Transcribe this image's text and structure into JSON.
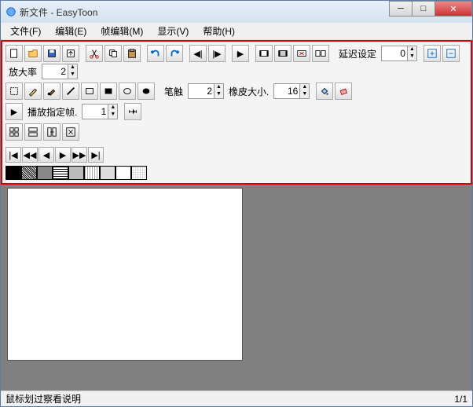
{
  "title": "新文件 - EasyToon",
  "menus": {
    "file": "文件(F)",
    "edit": "编辑(E)",
    "frame": "帧编辑(M)",
    "display": "显示(V)",
    "help": "帮助(H)"
  },
  "toolbar1": {
    "delay_label": "延迟设定",
    "delay_value": "0",
    "zoom_label": "放大率",
    "zoom_value": "2"
  },
  "toolbar2": {
    "pen_label": "笔触",
    "pen_value": "2",
    "eraser_label": "橡皮大小.",
    "eraser_value": "16"
  },
  "toolbar3": {
    "play_label": "播放指定帧.",
    "play_value": "1"
  },
  "icons": {
    "new": "new-icon",
    "open": "open-icon",
    "save": "save-icon",
    "export": "export-icon",
    "cut": "cut-icon",
    "copy": "copy-icon",
    "paste": "paste-icon",
    "undo": "undo-icon",
    "redo": "redo-icon",
    "prev": "prev-frame-icon",
    "next": "next-frame-icon",
    "play": "play-icon",
    "f1": "frame-insert-icon",
    "f2": "frame-dup-icon",
    "f3": "frame-del-icon",
    "f4": "frame-seq-icon",
    "zi": "zoom-in-icon",
    "zo": "zoom-out-icon",
    "sel": "select-icon",
    "pencil": "pencil-icon",
    "brush": "brush-icon",
    "line": "line-icon",
    "rect": "rect-icon",
    "rectf": "rect-fill-icon",
    "oval": "oval-icon",
    "ovalf": "oval-fill-icon",
    "fill": "fill-icon",
    "eraser": "eraser-icon",
    "first": "nav-first-icon",
    "bwd": "nav-bwd-icon",
    "pv": "nav-prev-icon",
    "nx": "nav-next-icon",
    "fw": "nav-fwd-icon",
    "last": "nav-last-icon"
  },
  "status": {
    "hint": "鼠标划过察看说明",
    "frame": "1/1"
  }
}
